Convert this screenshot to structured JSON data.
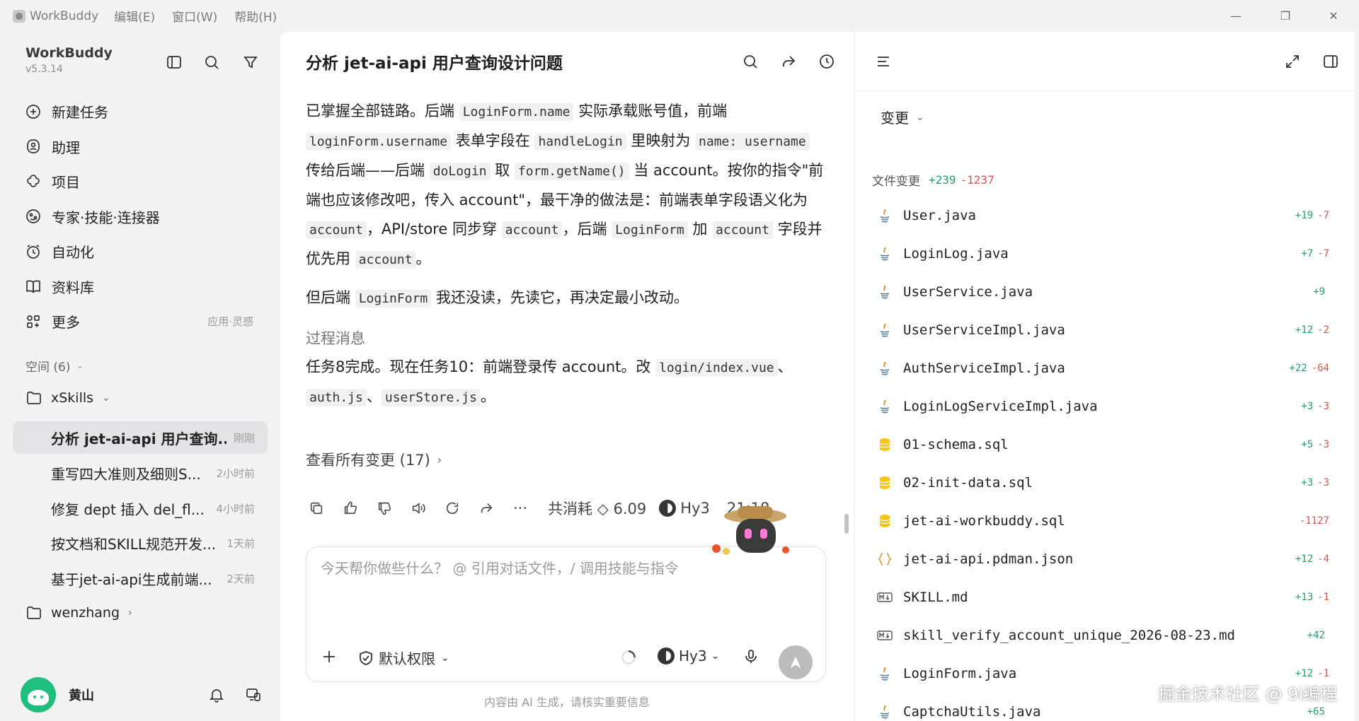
{
  "titlebar": {
    "app_name": "WorkBuddy",
    "menus": [
      "编辑(E)",
      "窗口(W)",
      "帮助(H)"
    ],
    "controls": {
      "minimize": "—",
      "restore": "❐",
      "close": "✕"
    }
  },
  "sidebar": {
    "brand_name": "WorkBuddy",
    "version": "v5.3.14",
    "nav": [
      {
        "label": "新建任务",
        "icon": "plus-circle-icon"
      },
      {
        "label": "助理",
        "icon": "assistant-icon"
      },
      {
        "label": "项目",
        "icon": "project-icon"
      },
      {
        "label": "专家·技能·连接器",
        "icon": "connector-icon"
      },
      {
        "label": "自动化",
        "icon": "alarm-icon"
      },
      {
        "label": "资料库",
        "icon": "book-icon"
      },
      {
        "label": "更多",
        "icon": "apps-icon",
        "sub": "应用·灵感"
      }
    ],
    "space_label": "空间 (6)",
    "groups": [
      {
        "label": "xSkills"
      },
      {
        "label": "wenzhang"
      }
    ],
    "conversations": [
      {
        "title": "分析 jet-ai-api 用户查询...",
        "time": "刚刚",
        "active": true
      },
      {
        "title": "重写四大准则及细则S...",
        "time": "2小时前"
      },
      {
        "title": "修复 dept 插入 del_fl...",
        "time": "4小时前"
      },
      {
        "title": "按文档和SKILL规范开发...",
        "time": "1天前"
      },
      {
        "title": "基于jet-ai-api生成前端...",
        "time": "2天前"
      }
    ],
    "user_name": "黄山"
  },
  "chat": {
    "title": "分析 jet-ai-api 用户查询设计问题",
    "message": {
      "t1": "已掌握全部链路。后端 ",
      "c1": "LoginForm.name",
      "t2": " 实际承载账号值，前端 ",
      "c2": "loginForm.username",
      "t3": " 表单字段在 ",
      "c3": "handleLogin",
      "t4": " 里映射为 ",
      "c4": "name: username",
      "t5": " 传给后端——后端 ",
      "c5": "doLogin",
      "t6": " 取 ",
      "c6": "form.getName()",
      "t7": " 当 account。按你的指令\"前端也应该修改吧，传入 account\"，最干净的做法是：前端表单字段语义化为 ",
      "c7": "account",
      "t8": "，API/store 同步穿 ",
      "c8": "account",
      "t9": "，后端 ",
      "c9": "LoginForm",
      "t10": " 加 ",
      "c10": "account",
      "t11": " 字段并优先用 ",
      "c11": "account",
      "t12": "。"
    },
    "message2": {
      "t1": "但后端 ",
      "c1": "LoginForm",
      "t2": " 我还没读，先读它，再决定最小改动。"
    },
    "process_label": "过程消息",
    "process": {
      "t1": "任务8完成。现在任务10：前端登录传 account。改 ",
      "c1": "login/index.vue",
      "t2": "、",
      "c2": "auth.js",
      "t3": "、",
      "c3": "userStore.js",
      "t4": "。"
    },
    "view_changes": "查看所有变更 (17)",
    "actions": {
      "more": "···",
      "cost_label": "共消耗",
      "cost_value": "6.09",
      "model": "Hy3",
      "time": "21:18"
    },
    "composer": {
      "placeholder": "今天帮你做些什么？ @ 引用对话文件，/ 调用技能与指令",
      "permission": "默认权限",
      "model": "Hy3"
    },
    "disclaimer": "内容由 AI 生成，请核实重要信息"
  },
  "right_panel": {
    "changes_select": "变更",
    "file_changes_label": "文件变更",
    "total_add": "+239",
    "total_del": "-1237",
    "files": [
      {
        "name": "User.java",
        "icon": "java-icon",
        "add": "+19",
        "del": "-7"
      },
      {
        "name": "LoginLog.java",
        "icon": "java-icon",
        "add": "+7",
        "del": "-7"
      },
      {
        "name": "UserService.java",
        "icon": "java-icon",
        "add": "+9",
        "del": ""
      },
      {
        "name": "UserServiceImpl.java",
        "icon": "java-icon",
        "add": "+12",
        "del": "-2"
      },
      {
        "name": "AuthServiceImpl.java",
        "icon": "java-icon",
        "add": "+22",
        "del": "-64"
      },
      {
        "name": "LoginLogServiceImpl.java",
        "icon": "java-icon",
        "add": "+3",
        "del": "-3"
      },
      {
        "name": "01-schema.sql",
        "icon": "database-icon",
        "add": "+5",
        "del": "-3"
      },
      {
        "name": "02-init-data.sql",
        "icon": "database-icon",
        "add": "+3",
        "del": "-3"
      },
      {
        "name": "jet-ai-workbuddy.sql",
        "icon": "database-icon",
        "add": "",
        "del": "-1127"
      },
      {
        "name": "jet-ai-api.pdman.json",
        "icon": "json-icon",
        "add": "+12",
        "del": "-4"
      },
      {
        "name": "SKILL.md",
        "icon": "markdown-icon",
        "add": "+13",
        "del": "-1"
      },
      {
        "name": "skill_verify_account_unique_2026-08-23.md",
        "icon": "markdown-icon",
        "add": "+42",
        "del": ""
      },
      {
        "name": "LoginForm.java",
        "icon": "java-icon",
        "add": "+12",
        "del": "-1"
      },
      {
        "name": "CaptchaUtils.java",
        "icon": "java-icon",
        "add": "+65",
        "del": ""
      }
    ]
  },
  "watermark": "掘金技术社区 @ 9i编程",
  "colors": {
    "add": "#21a366",
    "del": "#d9534f",
    "active_bg": "#e3e3e6",
    "db_icon": "#f5c518"
  }
}
